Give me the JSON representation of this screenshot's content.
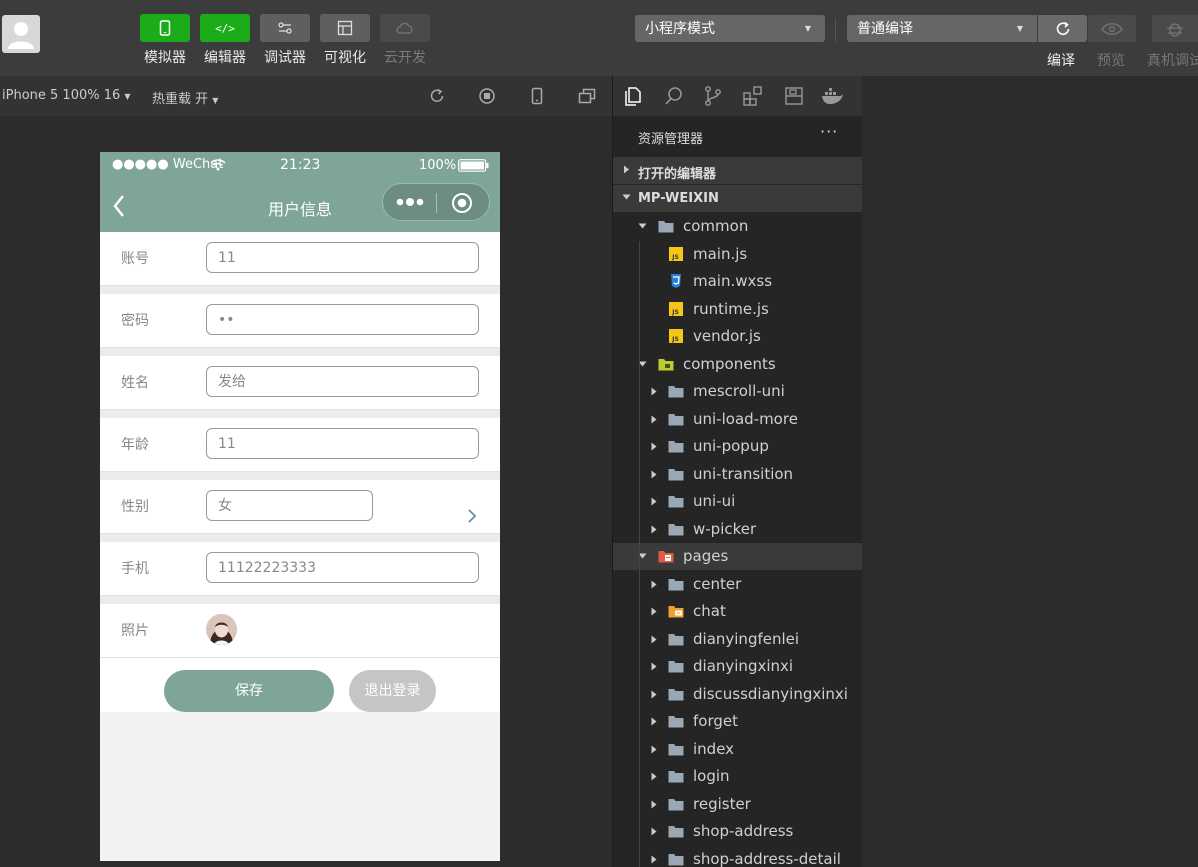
{
  "toolbar": {
    "buttons": [
      {
        "label": "模拟器",
        "icon": "phone-icon"
      },
      {
        "label": "编辑器",
        "icon": "code-icon",
        "glyph": "</>"
      },
      {
        "label": "调试器",
        "icon": "debug-icon"
      },
      {
        "label": "可视化",
        "icon": "layout-icon"
      },
      {
        "label": "云开发",
        "icon": "cloud-icon"
      }
    ],
    "mode_select": "小程序模式",
    "compile_select": "普通编译",
    "right_buttons": [
      {
        "label": "编译",
        "icon": "refresh-icon"
      },
      {
        "label": "预览",
        "icon": "eye-icon"
      },
      {
        "label": "真机调试",
        "icon": "bug-icon"
      }
    ]
  },
  "simbar": {
    "device": "iPhone 5 100% 16",
    "hot_reload": "热重载 开"
  },
  "phone": {
    "carrier": "●●●●● WeChat",
    "time": "21:23",
    "battery": "100%",
    "title": "用户信息",
    "fields": [
      {
        "label": "账号",
        "value": "11"
      },
      {
        "label": "密码",
        "value": "••"
      },
      {
        "label": "姓名",
        "value": "发给"
      },
      {
        "label": "年龄",
        "value": "11"
      },
      {
        "label": "性别",
        "value": "女"
      },
      {
        "label": "手机",
        "value": "11122223333"
      }
    ],
    "photo_label": "照片",
    "save_label": "保存",
    "logout_label": "退出登录"
  },
  "explorer": {
    "title": "资源管理器",
    "more": "···",
    "open_editors": "打开的编辑器",
    "project": "MP-WEIXIN",
    "tree": [
      {
        "label": "common",
        "type": "folder",
        "level": 1,
        "open": true
      },
      {
        "label": "main.js",
        "type": "js",
        "level": 2
      },
      {
        "label": "main.wxss",
        "type": "css",
        "level": 2
      },
      {
        "label": "runtime.js",
        "type": "js",
        "level": 2
      },
      {
        "label": "vendor.js",
        "type": "js",
        "level": 2
      },
      {
        "label": "components",
        "type": "folder-components",
        "level": 1,
        "open": true
      },
      {
        "label": "mescroll-uni",
        "type": "folder",
        "level": 2
      },
      {
        "label": "uni-load-more",
        "type": "folder",
        "level": 2
      },
      {
        "label": "uni-popup",
        "type": "folder",
        "level": 2
      },
      {
        "label": "uni-transition",
        "type": "folder",
        "level": 2
      },
      {
        "label": "uni-ui",
        "type": "folder",
        "level": 2
      },
      {
        "label": "w-picker",
        "type": "folder",
        "level": 2
      },
      {
        "label": "pages",
        "type": "folder-pages",
        "level": 1,
        "open": true,
        "selected": true
      },
      {
        "label": "center",
        "type": "folder",
        "level": 2
      },
      {
        "label": "chat",
        "type": "folder-chat",
        "level": 2
      },
      {
        "label": "dianyingfenlei",
        "type": "folder",
        "level": 2
      },
      {
        "label": "dianyingxinxi",
        "type": "folder",
        "level": 2
      },
      {
        "label": "discussdianyingxinxi",
        "type": "folder",
        "level": 2
      },
      {
        "label": "forget",
        "type": "folder",
        "level": 2
      },
      {
        "label": "index",
        "type": "folder",
        "level": 2
      },
      {
        "label": "login",
        "type": "folder",
        "level": 2
      },
      {
        "label": "register",
        "type": "folder",
        "level": 2
      },
      {
        "label": "shop-address",
        "type": "folder",
        "level": 2
      },
      {
        "label": "shop-address-detail",
        "type": "folder",
        "level": 2
      }
    ]
  }
}
